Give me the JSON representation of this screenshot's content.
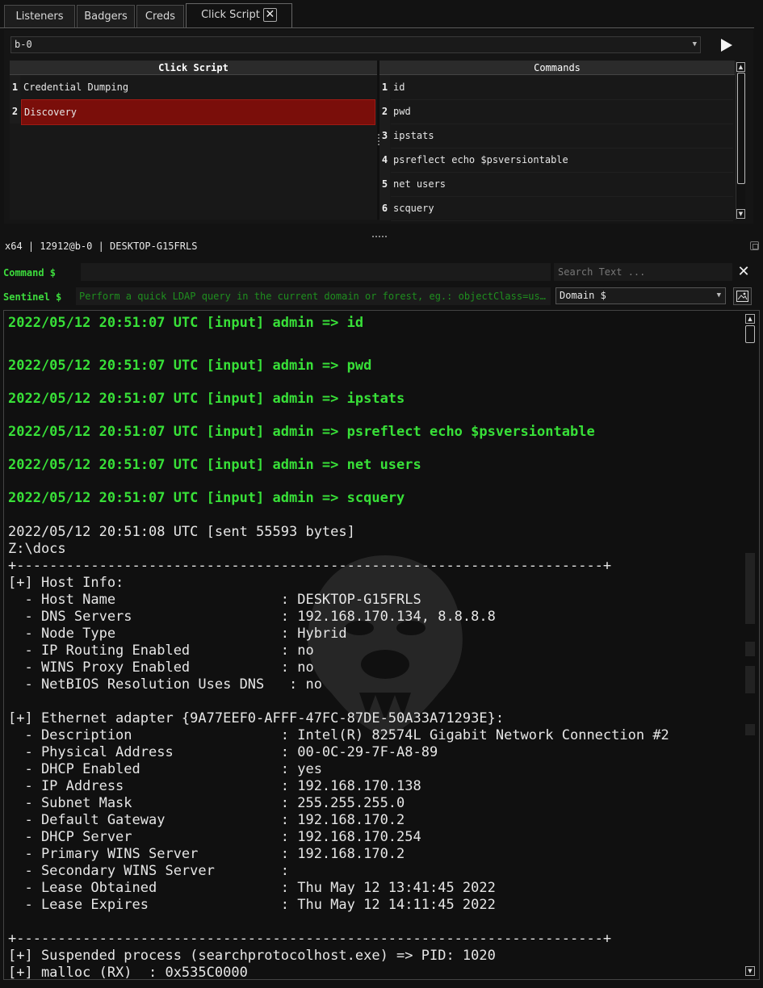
{
  "tabs": [
    {
      "label": "Listeners"
    },
    {
      "label": "Badgers"
    },
    {
      "label": "Creds"
    },
    {
      "label": "Click Script",
      "close": "✕"
    }
  ],
  "click_script": {
    "badger_select": "b-0",
    "left_header": "Click Script",
    "right_header": "Commands",
    "scripts": [
      {
        "num": "1",
        "label": "Credential Dumping",
        "selected": false
      },
      {
        "num": "2",
        "label": "Discovery",
        "selected": true
      }
    ],
    "commands": [
      {
        "num": "1",
        "label": "id"
      },
      {
        "num": "2",
        "label": "pwd"
      },
      {
        "num": "3",
        "label": "ipstats"
      },
      {
        "num": "4",
        "label": "psreflect echo $psversiontable"
      },
      {
        "num": "5",
        "label": "net users"
      },
      {
        "num": "6",
        "label": "scquery"
      }
    ]
  },
  "status": {
    "text": "x64 | 12912@b-0 | DESKTOP-G15FRLS"
  },
  "command": {
    "label": "Command $",
    "value": "",
    "search_placeholder": "Search Text ...",
    "close": "✕"
  },
  "sentinel": {
    "label": "Sentinel $",
    "placeholder": "Perform a quick LDAP query in the current domain or forest, eg.: objectClass=us…",
    "domain_select": "Domain $"
  },
  "console": {
    "lines": [
      {
        "text": "2022/05/12 20:51:07 UTC [input] admin => id",
        "type": "input"
      },
      {
        "text": "2022/05/12 20:51:07 UTC [input] admin => pwd",
        "type": "input"
      },
      {
        "text": "2022/05/12 20:51:07 UTC [input] admin => ipstats",
        "type": "input"
      },
      {
        "text": "2022/05/12 20:51:07 UTC [input] admin => psreflect echo $psversiontable",
        "type": "input"
      },
      {
        "text": "2022/05/12 20:51:07 UTC [input] admin => net users",
        "type": "input"
      },
      {
        "text": "2022/05/12 20:51:07 UTC [input] admin => scquery",
        "type": "input"
      },
      {
        "text": "2022/05/12 20:51:08 UTC [sent 55593 bytes]",
        "type": "output"
      },
      {
        "text": "Z:\\docs",
        "type": "output"
      },
      {
        "text": "+-----------------------------------------------------------------------+",
        "type": "output"
      },
      {
        "text": "[+] Host Info:",
        "type": "output"
      },
      {
        "text": "  - Host Name                    : DESKTOP-G15FRLS",
        "type": "output"
      },
      {
        "text": "  - DNS Servers                  : 192.168.170.134, 8.8.8.8",
        "type": "output"
      },
      {
        "text": "  - Node Type                    : Hybrid",
        "type": "output"
      },
      {
        "text": "  - IP Routing Enabled           : no",
        "type": "output"
      },
      {
        "text": "  - WINS Proxy Enabled           : no",
        "type": "output"
      },
      {
        "text": "  - NetBIOS Resolution Uses DNS   : no",
        "type": "output"
      },
      {
        "text": "[+] Ethernet adapter {9A77EEF0-AFFF-47FC-87DE-50A33A71293E}:",
        "type": "output"
      },
      {
        "text": "  - Description                  : Intel(R) 82574L Gigabit Network Connection #2",
        "type": "output"
      },
      {
        "text": "  - Physical Address             : 00-0C-29-7F-A8-89",
        "type": "output"
      },
      {
        "text": "  - DHCP Enabled                 : yes",
        "type": "output"
      },
      {
        "text": "  - IP Address                   : 192.168.170.138",
        "type": "output"
      },
      {
        "text": "  - Subnet Mask                  : 255.255.255.0",
        "type": "output"
      },
      {
        "text": "  - Default Gateway              : 192.168.170.2",
        "type": "output"
      },
      {
        "text": "  - DHCP Server                  : 192.168.170.254",
        "type": "output"
      },
      {
        "text": "  - Primary WINS Server          : 192.168.170.2",
        "type": "output"
      },
      {
        "text": "  - Secondary WINS Server        :",
        "type": "output"
      },
      {
        "text": "  - Lease Obtained               : Thu May 12 13:41:45 2022",
        "type": "output"
      },
      {
        "text": "  - Lease Expires                : Thu May 12 14:11:45 2022",
        "type": "output"
      },
      {
        "text": "+-----------------------------------------------------------------------+",
        "type": "output"
      },
      {
        "text": "[+] Suspended process (searchprotocolhost.exe) => PID: 1020",
        "type": "output"
      },
      {
        "text": "[+] malloc (RX)  : 0x535C0000",
        "type": "output"
      }
    ]
  },
  "colors": {
    "accent_green": "#38e038",
    "selection_red": "#7a0e0a"
  }
}
